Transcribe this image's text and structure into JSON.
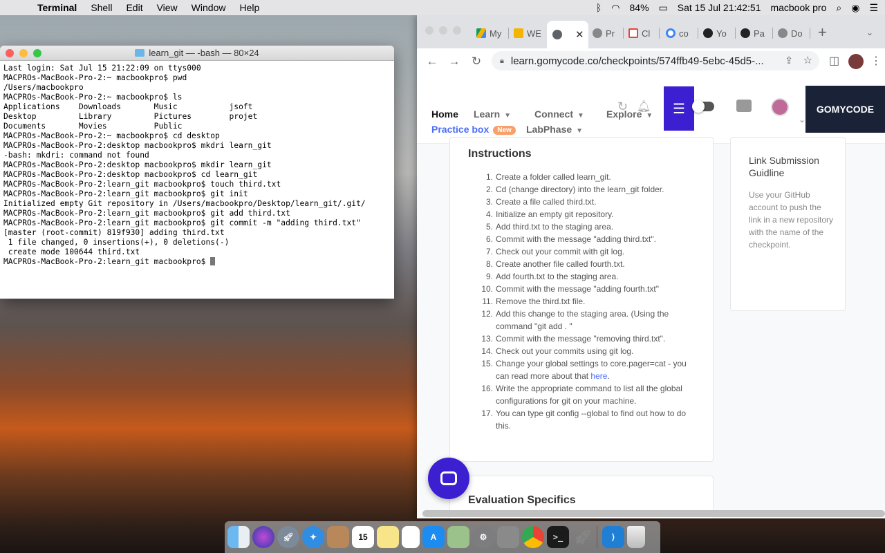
{
  "menubar": {
    "app_name": "Terminal",
    "menus": [
      "Shell",
      "Edit",
      "View",
      "Window",
      "Help"
    ],
    "battery": "84%",
    "datetime": "Sat 15 Jul  21:42:51",
    "user": "macbook pro"
  },
  "terminal": {
    "title": "learn_git — -bash — 80×24",
    "lines": [
      "Last login: Sat Jul 15 21:22:09 on ttys000",
      "MACPROs-MacBook-Pro-2:~ macbookpro$ pwd",
      "/Users/macbookpro",
      "MACPROs-MacBook-Pro-2:~ macbookpro$ ls",
      "Applications    Downloads       Music           jsoft",
      "Desktop         Library         Pictures        projet",
      "Documents       Movies          Public",
      "MACPROs-MacBook-Pro-2:~ macbookpro$ cd desktop",
      "MACPROs-MacBook-Pro-2:desktop macbookpro$ mkdri learn_git",
      "-bash: mkdri: command not found",
      "MACPROs-MacBook-Pro-2:desktop macbookpro$ mkdir learn_git",
      "MACPROs-MacBook-Pro-2:desktop macbookpro$ cd learn_git",
      "MACPROs-MacBook-Pro-2:learn_git macbookpro$ touch third.txt",
      "MACPROs-MacBook-Pro-2:learn_git macbookpro$ git init",
      "Initialized empty Git repository in /Users/macbookpro/Desktop/learn_git/.git/",
      "MACPROs-MacBook-Pro-2:learn_git macbookpro$ git add third.txt",
      "MACPROs-MacBook-Pro-2:learn_git macbookpro$ git commit -m \"adding third.txt\"",
      "[master (root-commit) 819f930] adding third.txt",
      " 1 file changed, 0 insertions(+), 0 deletions(-)",
      " create mode 100644 third.txt",
      "MACPROs-MacBook-Pro-2:learn_git macbookpro$ "
    ]
  },
  "browser": {
    "tabs": [
      {
        "label": "My",
        "icon": "google-drive-icon"
      },
      {
        "label": "WE",
        "icon": "slides-icon"
      },
      {
        "label": "",
        "icon": "globe-icon",
        "active": true
      },
      {
        "label": "Pr",
        "icon": "globe-icon"
      },
      {
        "label": "Cl",
        "icon": "gmail-icon"
      },
      {
        "label": "co",
        "icon": "google-icon"
      },
      {
        "label": "Yo",
        "icon": "github-icon"
      },
      {
        "label": "Pa",
        "icon": "github-icon"
      },
      {
        "label": "Do",
        "icon": "globe-icon"
      }
    ],
    "url": "learn.gomycode.co/checkpoints/574ffb49-5ebc-45d5-..."
  },
  "site": {
    "nav": {
      "home": "Home",
      "learn": "Learn",
      "connect": "Connect",
      "explore": "Explore",
      "practice_box": "Practice box",
      "new_badge": "New",
      "labphase": "LabPhase"
    },
    "logo": "GOMYCODE",
    "instructions_title": "Instructions",
    "steps": [
      "Create a folder called learn_git.",
      "Cd (change directory) into the learn_git folder.",
      "Create a file called third.txt.",
      "Initialize an empty git repository.",
      "Add third.txt to the staging area.",
      "Commit with the message \"adding third.txt\".",
      "Check out your commit with git log.",
      "Create another file called fourth.txt.",
      "Add fourth.txt to the staging area.",
      "Commit with the message \"adding fourth.txt\"",
      "Remove the third.txt file.",
      "Add this change to the staging area. (Using the command \"git add . \"",
      "Commit with the message \"removing third.txt\".",
      "Check out your commits using git log.",
      "Change your global settings to core.pager=cat - you can read more about that ",
      "Write the appropriate command to list all the global configurations for git on your machine.",
      "You can type git config --global to find out how to do this."
    ],
    "step15_link": "here",
    "side_title": "Link Submission Guidline",
    "side_body": "Use your GitHub account to push the link in a new repository with the name of the checkpoint.",
    "eval_title": "Evaluation Specifics"
  },
  "dock": {
    "calendar_day": "15",
    "items": [
      "finder-icon",
      "siri-icon",
      "launchpad-icon",
      "safari-icon",
      "contacts-icon",
      "calendar-icon",
      "notes-icon",
      "reminders-icon",
      "app-store-icon",
      "preview-icon",
      "system-preferences-icon",
      "calculator-icon",
      "chrome-icon",
      "terminal-icon",
      "rocket-icon",
      "vscode-icon",
      "trash-icon"
    ]
  }
}
